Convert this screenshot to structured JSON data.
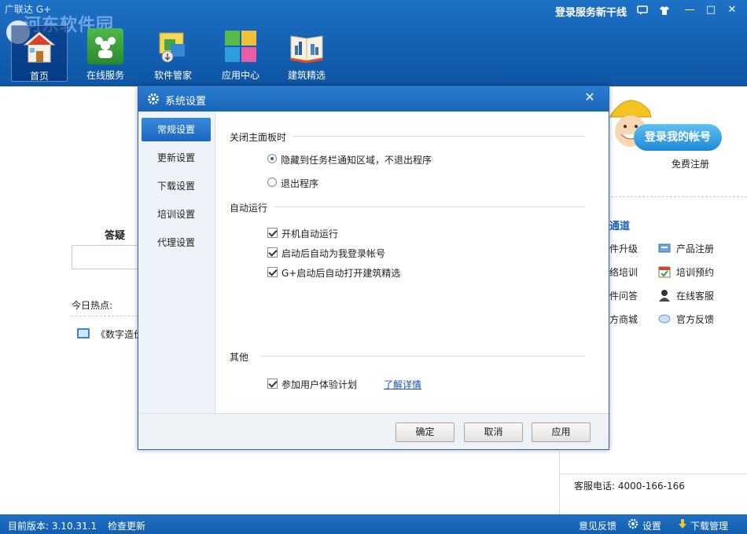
{
  "app": {
    "title": "广联达 G+",
    "watermark": "河东软件园",
    "login_service_label": "登录服务新干线"
  },
  "window_controls": {
    "feedback_icon": "message-icon",
    "skin_icon": "shirt-icon",
    "minimize": "—",
    "maximize": "□",
    "close": "✕"
  },
  "nav": {
    "items": [
      {
        "label": "首页",
        "icon": "home-icon"
      },
      {
        "label": "在线服务",
        "icon": "online-service-icon"
      },
      {
        "label": "软件管家",
        "icon": "software-manager-icon"
      },
      {
        "label": "应用中心",
        "icon": "app-center-icon"
      },
      {
        "label": "建筑精选",
        "icon": "book-icon"
      }
    ]
  },
  "main": {
    "answer_label": "答疑",
    "hot_label": "今日热点:",
    "hot_item": "《数字造价",
    "login_button": "登录我的帐号",
    "free_register": "免费注册",
    "channel_title": "通道",
    "channel_links": [
      "件升级",
      "产品注册",
      "络培训",
      "培训预约",
      "件问答",
      "在线客服",
      "方商城",
      "官方反馈"
    ],
    "phone": "客服电话: 4000-166-166"
  },
  "statusbar": {
    "version": "目前版本: 3.10.31.1",
    "check_update": "检查更新",
    "feedback": "意见反馈",
    "settings": "设置",
    "download_manager": "下载管理"
  },
  "dialog": {
    "title": "系统设置",
    "close": "✕",
    "sidebar": [
      "常规设置",
      "更新设置",
      "下载设置",
      "培训设置",
      "代理设置"
    ],
    "sections": {
      "close_panel": {
        "title": "关闭主面板时",
        "options": [
          "隐藏到任务栏通知区域，不退出程序",
          "退出程序"
        ],
        "selected": 0
      },
      "autorun": {
        "title": "自动运行",
        "options": [
          {
            "label": "开机自动运行",
            "checked": true
          },
          {
            "label": "启动后自动为我登录帐号",
            "checked": true
          },
          {
            "label": "G+启动后自动打开建筑精选",
            "checked": true
          }
        ]
      },
      "other": {
        "title": "其他",
        "options": [
          {
            "label": "参加用户体验计划",
            "checked": true
          }
        ],
        "link": "了解详情"
      }
    },
    "buttons": {
      "ok": "确定",
      "cancel": "取消",
      "apply": "应用"
    }
  },
  "colors": {
    "header_blue": "#135fb1",
    "accent_blue": "#1a67be",
    "link_blue": "#1a4fb6"
  }
}
